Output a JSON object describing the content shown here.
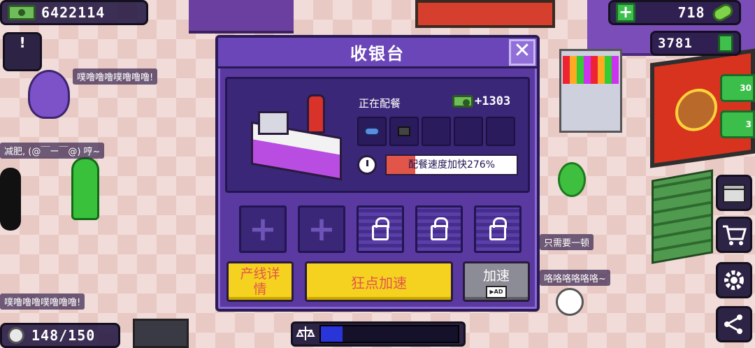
{
  "hud": {
    "money": "6422114",
    "gems": "718",
    "cash2": "3781",
    "visitors": "148/150"
  },
  "chat": {
    "b1": "噗噜噜噜噗噜噜噜!",
    "b2": "减肥, (@￣ー￣@) 哼~",
    "b3": "噗噜噜噜噗噜噜噜!",
    "b4": "只需要一顿",
    "b5": "咯咯咯咯咯咯~"
  },
  "alert": {
    "mark": "!"
  },
  "side": {
    "tab1": "30",
    "tab2": "3"
  },
  "modal": {
    "title": "收银台",
    "close": "✕",
    "staffing_label": "正在配餐",
    "income": "+1303",
    "speed_text": "配餐速度加快276%",
    "speed_fill_pct": 22,
    "upgrade_plus": "+",
    "buttons": {
      "detail": "产线详情",
      "tap": "狂点加速",
      "speed": "加速",
      "ad": "▶AD"
    }
  },
  "bottom_progress": {
    "fill_pct": 16
  },
  "colors": {
    "modal_bg": "#5a3aa0",
    "button_yellow": "#f5d21f",
    "button_text_red": "#e2564a",
    "button_gray": "#8c8c96"
  },
  "icons": [
    "cash-icon",
    "plus-icon",
    "gem-icon",
    "cash-can-icon",
    "person-icon",
    "close-icon",
    "timer-icon",
    "lock-icon",
    "gift-icon",
    "cart-icon",
    "gear-icon",
    "share-icon",
    "ad-icon"
  ]
}
